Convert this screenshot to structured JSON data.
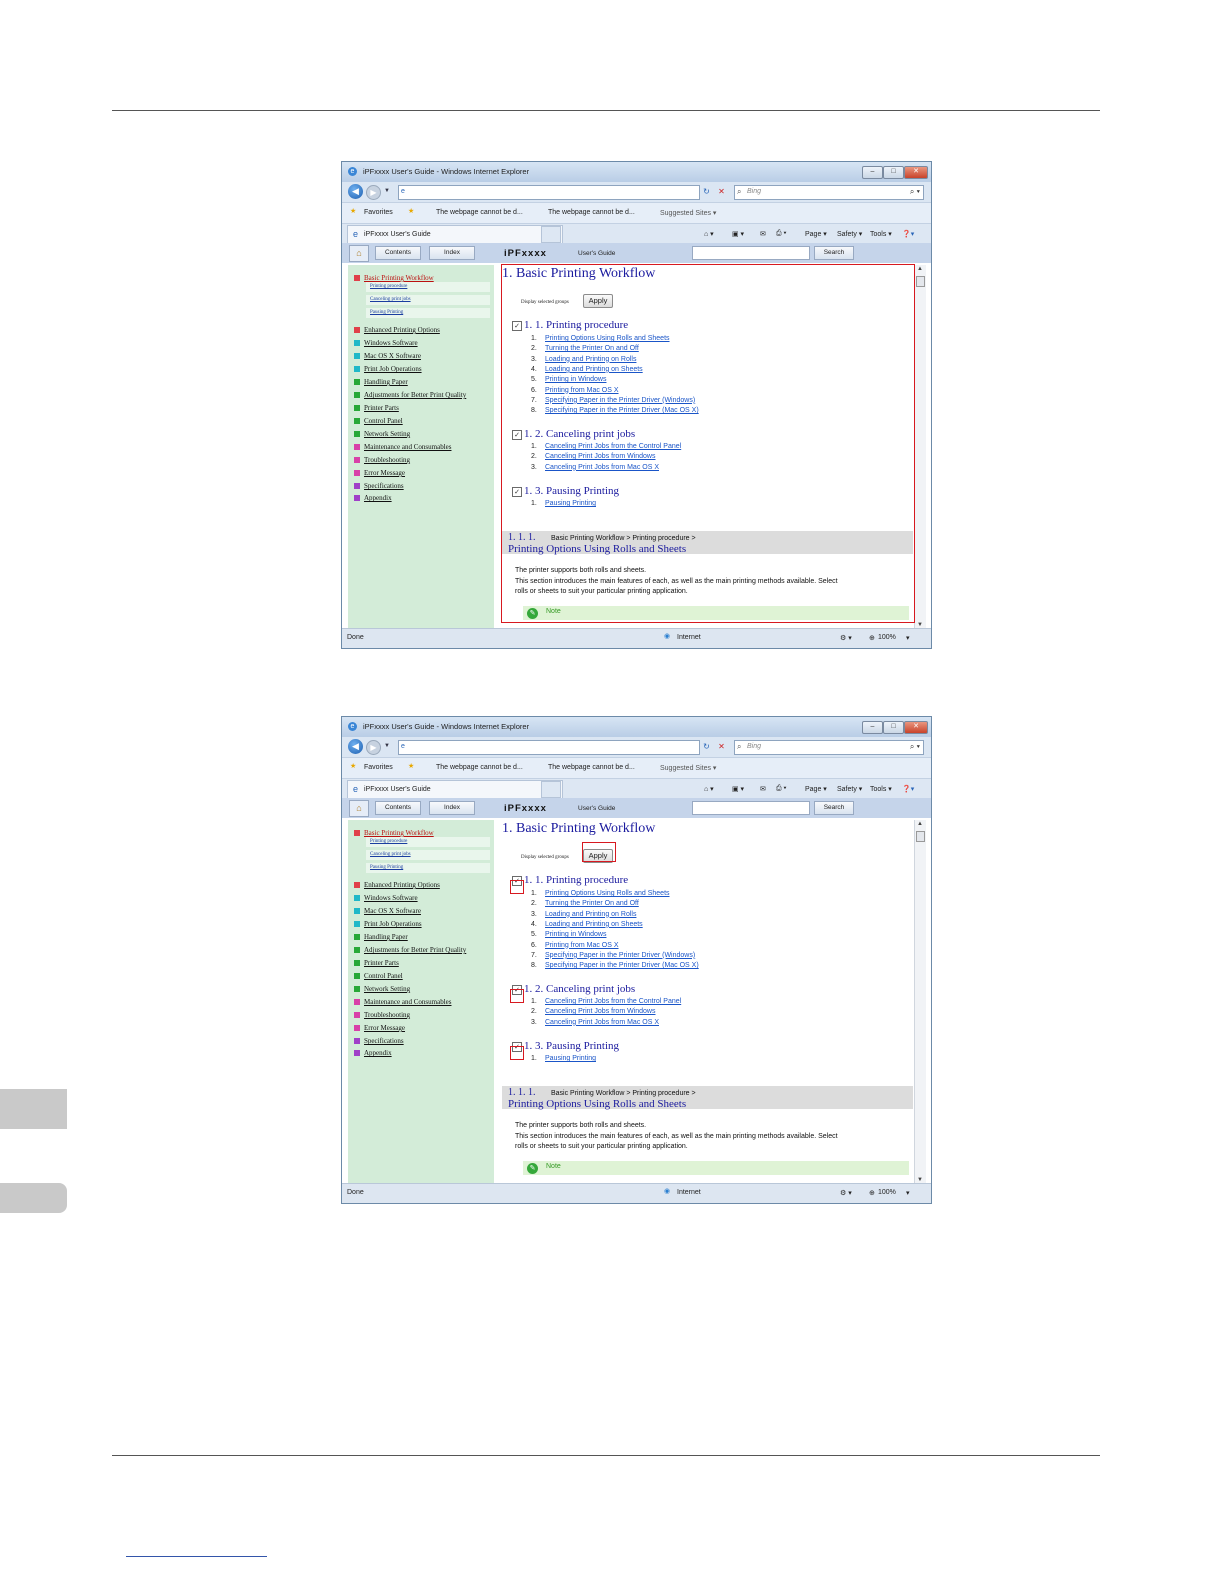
{
  "browser": {
    "title": "iPFxxxx User's Guide - Windows Internet Explorer",
    "search_placeholder": "Bing",
    "favorites_label": "Favorites",
    "favorite_links": [
      "The webpage cannot be d...",
      "The webpage cannot be d...",
      "Suggested Sites ▾"
    ],
    "tab_label": "iPFxxxx User's Guide",
    "commands": [
      "Page ▾",
      "Safety ▾",
      "Tools ▾"
    ],
    "status_left": "Done",
    "status_zone": "Internet",
    "zoom": "100%"
  },
  "guide": {
    "contents_tab": "Contents",
    "index_tab": "Index",
    "brand": "iPFxxxx",
    "brand_sub": "User's Guide",
    "search_button": "Search",
    "toc": [
      {
        "label": "Basic Printing Workflow",
        "color": "#e0404a"
      },
      {
        "label": "Enhanced Printing Options",
        "color": "#e0404a"
      },
      {
        "label": "Windows Software",
        "color": "#20b8c8"
      },
      {
        "label": "Mac OS X Software",
        "color": "#20b8c8"
      },
      {
        "label": "Print Job Operations",
        "color": "#20b8c8"
      },
      {
        "label": "Handling Paper",
        "color": "#28a838"
      },
      {
        "label": "Adjustments for Better Print Quality",
        "color": "#28a838"
      },
      {
        "label": "Printer Parts",
        "color": "#28a838"
      },
      {
        "label": "Control Panel",
        "color": "#28a838"
      },
      {
        "label": "Network Setting",
        "color": "#28a838"
      },
      {
        "label": "Maintenance and Consumables",
        "color": "#d840a8"
      },
      {
        "label": "Troubleshooting",
        "color": "#d840a8"
      },
      {
        "label": "Error Message",
        "color": "#d840a8"
      },
      {
        "label": "Specifications",
        "color": "#a040c8"
      },
      {
        "label": "Appendix",
        "color": "#a040c8"
      }
    ],
    "toc_sub": [
      "Printing procedure",
      "Canceling print jobs",
      "Pausing Printing"
    ],
    "page_title": "1. Basic Printing Workflow",
    "display_selected_groups": "Display selected groups",
    "apply_button": "Apply",
    "sections": [
      {
        "title": "1. 1. Printing procedure",
        "items": [
          "Printing Options Using Rolls and Sheets",
          "Turning the Printer On and Off",
          "Loading and Printing on Rolls",
          "Loading and Printing on Sheets",
          "Printing in Windows",
          "Printing from Mac OS X",
          "Specifying Paper in the Printer Driver (Windows)",
          "Specifying Paper in the Printer Driver (Mac OS X)"
        ]
      },
      {
        "title": "1. 2. Canceling print jobs",
        "items": [
          "Canceling Print Jobs from the Control Panel",
          "Canceling Print Jobs from Windows",
          "Canceling Print Jobs from Mac OS X"
        ]
      },
      {
        "title": "1. 3. Pausing Printing",
        "items": [
          "Pausing Printing"
        ]
      }
    ],
    "subsection_number": "1. 1. 1.",
    "breadcrumb": "Basic Printing Workflow > Printing procedure >",
    "subsection_title": "Printing Options Using Rolls and Sheets",
    "body_lines": [
      "The printer supports both rolls and sheets.",
      "This section introduces the main features of each, as well as the main printing methods available. Select",
      "rolls or sheets to suit your particular printing application."
    ],
    "note_label": "Note"
  }
}
